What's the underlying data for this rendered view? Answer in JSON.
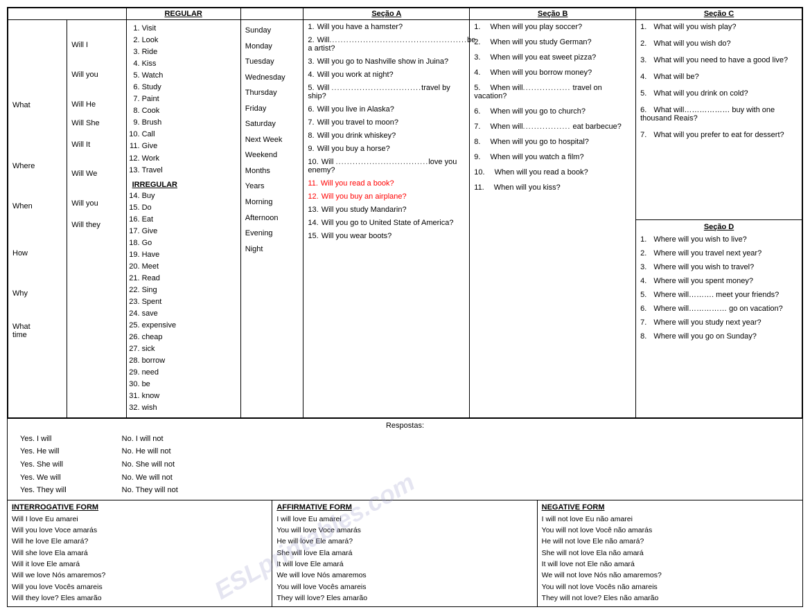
{
  "wh_words": [
    "What",
    "",
    "",
    "",
    "",
    "Where",
    "",
    "",
    "",
    "When",
    "",
    "",
    "",
    "How",
    "",
    "",
    "",
    "Why",
    "",
    "",
    "What time"
  ],
  "will_words": [
    "",
    "Will I",
    "",
    "",
    "",
    "",
    "Will you",
    "",
    "Will He",
    "",
    "Will She",
    "",
    "Will It",
    "",
    "Will We",
    "",
    "Will you",
    "",
    "Will they",
    "",
    ""
  ],
  "regular_header": "REGULAR",
  "regular_list": [
    "Visit",
    "Look",
    "Ride",
    "Kiss",
    "Watch",
    "Study",
    "Paint",
    "Cook",
    "Brush",
    "Call",
    "Give",
    "Work",
    "Travel"
  ],
  "irregular_header": "IRREGULAR",
  "irregular_list": [
    "Buy",
    "Do",
    "Eat",
    "Give",
    "Go",
    "Have",
    "Meet",
    "Read",
    "Sing",
    "Spent",
    "save",
    "expensive",
    "cheap",
    "sick",
    "borrow",
    "need",
    "be",
    "know",
    "wish"
  ],
  "days": [
    "Sunday",
    "Monday",
    "Tuesday",
    "Wednesday",
    "Thursday",
    "Friday",
    "Saturday",
    "Next  Week",
    "Weekend",
    "Months",
    "Years",
    "Morning",
    "Afternoon",
    "Evening",
    "Night"
  ],
  "secao_a_header": "Seção A",
  "secao_a_items": [
    {
      "num": "1.",
      "text": "Will you have a hamster?"
    },
    {
      "num": "2.",
      "text": "Will.................................................be a artist?"
    },
    {
      "num": "3.",
      "text": "Will you go to Nashville show in Juina?"
    },
    {
      "num": "4.",
      "text": "Will you work at night?"
    },
    {
      "num": "5.",
      "text": "Will ................................travel by ship?"
    },
    {
      "num": "6.",
      "text": "Will you live in Alaska?"
    },
    {
      "num": "7.",
      "text": "Will you travel to moon?"
    },
    {
      "num": "8.",
      "text": "Will you drink whiskey?"
    },
    {
      "num": "9.",
      "text": "Will you buy a horse?"
    },
    {
      "num": "10.",
      "text": "Will .................................love you enemy?"
    },
    {
      "num": "11.",
      "text": "Will you read a book?",
      "red": true
    },
    {
      "num": "12.",
      "text": "Will you buy an airplane?",
      "red": true
    },
    {
      "num": "13.",
      "text": "Will you study Mandarin?"
    },
    {
      "num": "14.",
      "text": "Will you go to United State of America?"
    },
    {
      "num": "15.",
      "text": "Will you wear boots?"
    }
  ],
  "secao_b_header": "Seção B",
  "secao_b_items": [
    {
      "num": "1.",
      "text": "When will you play soccer?"
    },
    {
      "num": "2.",
      "text": "When will you study German?"
    },
    {
      "num": "3.",
      "text": "When will you eat sweet pizza?"
    },
    {
      "num": "4.",
      "text": "When will you borrow money?"
    },
    {
      "num": "5.",
      "text": "When will............... travel on vacation?"
    },
    {
      "num": "6.",
      "text": "When will you go to church?"
    },
    {
      "num": "7.",
      "text": "When will................. eat barbecue?"
    },
    {
      "num": "8.",
      "text": "When will you go to hospital?"
    },
    {
      "num": "9.",
      "text": "When will you watch a film?"
    },
    {
      "num": "10.",
      "text": "When will you read a book?"
    },
    {
      "num": "11.",
      "text": "When will you kiss?"
    }
  ],
  "secao_c_header": "Seção C",
  "secao_c_items": [
    {
      "num": "1.",
      "text": "What will you wish play?"
    },
    {
      "num": "2.",
      "text": "What will you wish do?"
    },
    {
      "num": "3.",
      "text": "What will you need to have a good live?"
    },
    {
      "num": "4.",
      "text": "What will be?"
    },
    {
      "num": "5.",
      "text": "What will you drink on cold?"
    },
    {
      "num": "6.",
      "text": "What will……………… buy with one thousand Reais?"
    },
    {
      "num": "7.",
      "text": "What will you prefer to eat for dessert?"
    }
  ],
  "secao_d_header": "Seção D",
  "secao_d_items": [
    {
      "num": "1.",
      "text": "Where will you wish to live?"
    },
    {
      "num": "2.",
      "text": "Where will you travel next year?"
    },
    {
      "num": "3.",
      "text": "Where will you wish to travel?"
    },
    {
      "num": "4.",
      "text": "Where will you spent money?"
    },
    {
      "num": "5.",
      "text": "Where will………. meet your friends?"
    },
    {
      "num": "6.",
      "text": "Where will…………… go on vacation?"
    },
    {
      "num": "7.",
      "text": "Where will you study next year?"
    },
    {
      "num": "8.",
      "text": "Where will you go on Sunday?"
    }
  ],
  "respostas_label": "Respostas:",
  "respostas_yes": [
    "Yes. I will",
    "Yes. He will",
    "Yes. She will",
    "Yes. We will",
    "Yes. They will"
  ],
  "respostas_no": [
    "No. I will  not",
    "No. He  will  not",
    "No. She  will not",
    "No. We will  not",
    "No. They will  not"
  ],
  "interrogative_header": "INTERROGATIVE FORM",
  "affirmative_header": "AFFIRMATIVE FORM",
  "negative_header": "NEGATIVE FORM",
  "interrogative_rows": [
    "Will I love Eu amarei",
    "Will you love Voce amarás",
    "Will he love Ele amará?",
    "Will she love Ela amará",
    "Will it love Ele amará",
    "Will we love  Nós amaremos?",
    "Will you love Vocês amareis",
    "Will they love? Eles amarão"
  ],
  "affirmative_rows": [
    "I will love Eu amarei",
    "You will love Voce amarás",
    "He will love Ele amará?",
    "She will love Ela amará",
    "It will love Ele amará",
    "We will love  Nós amaremos",
    "You will love Vocês amareis",
    "They will love? Eles amarão"
  ],
  "negative_rows": [
    "I will not love Eu  não amarei",
    "You will not love Você não amarás",
    "He will not love Ele não amará?",
    "She will not love Ela não  amará",
    "It will love not Ele não amará",
    "We will not love  Nós não amaremos?",
    "You will not love Vocês não amareis",
    "They will not love? Eles não amarão"
  ]
}
